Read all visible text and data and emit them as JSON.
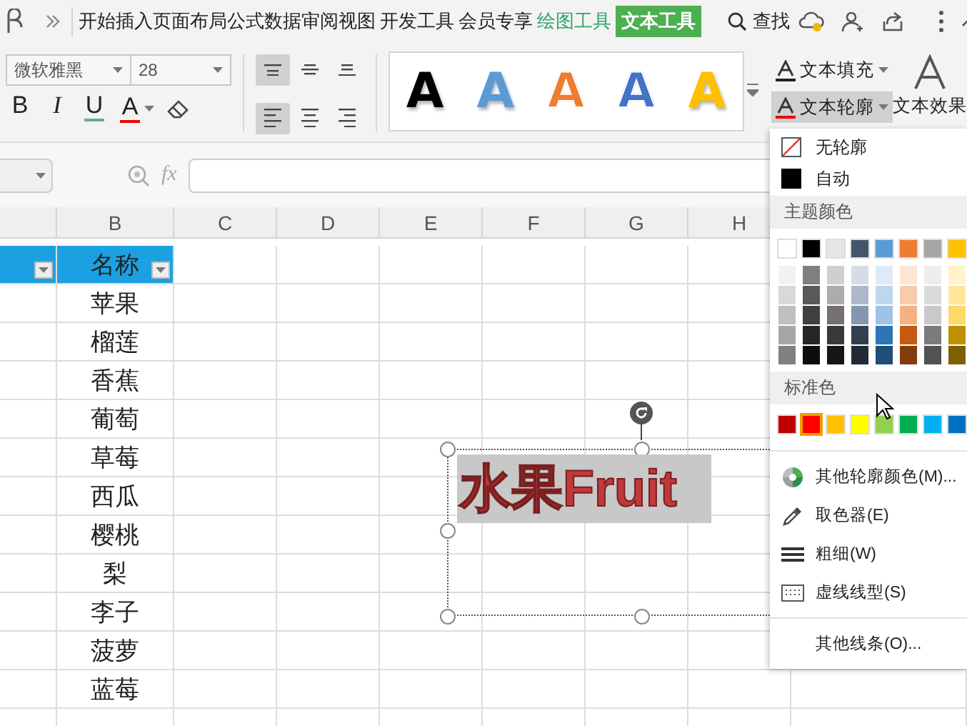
{
  "title_bar": {
    "tabs": [
      {
        "label": "开始",
        "kind": "normal",
        "selected": false
      },
      {
        "label": "插入",
        "kind": "normal",
        "selected": false
      },
      {
        "label": "页面布局",
        "kind": "normal",
        "selected": false
      },
      {
        "label": "公式",
        "kind": "normal",
        "selected": false
      },
      {
        "label": "数据",
        "kind": "normal",
        "selected": false
      },
      {
        "label": "审阅",
        "kind": "normal",
        "selected": false
      },
      {
        "label": "视图",
        "kind": "normal",
        "selected": false
      },
      {
        "label": "开发工具",
        "kind": "normal",
        "selected": false
      },
      {
        "label": "会员专享",
        "kind": "normal",
        "selected": false
      },
      {
        "label": "绘图工具",
        "kind": "context",
        "selected": false
      },
      {
        "label": "文本工具",
        "kind": "context",
        "selected": true
      }
    ],
    "search": "查找"
  },
  "ribbon": {
    "font_name": "微软雅黑",
    "font_size": "28",
    "format_buttons": [
      {
        "kind": "bold",
        "label": "B"
      },
      {
        "kind": "italic",
        "label": "I"
      },
      {
        "kind": "underline",
        "label": "U"
      },
      {
        "kind": "font_color",
        "label": "A"
      }
    ],
    "align_buttons": [
      {
        "kind": "top",
        "selected": true
      },
      {
        "kind": "middle",
        "selected": false
      },
      {
        "kind": "bottom",
        "selected": false
      },
      {
        "kind": "left",
        "selected": true
      },
      {
        "kind": "center",
        "selected": false
      },
      {
        "kind": "right",
        "selected": false
      }
    ],
    "text_styles": [
      {
        "label": "A",
        "kind": "fill",
        "color": "#000000"
      },
      {
        "label": "A",
        "kind": "fill",
        "color": "#5b9bd5"
      },
      {
        "label": "A",
        "kind": "outline",
        "color": "#ed7d31"
      },
      {
        "label": "A",
        "kind": "outline",
        "color": "#4472c4"
      },
      {
        "label": "A",
        "kind": "fill",
        "color": "#ffc000"
      }
    ],
    "text_fill": "文本填充",
    "text_outline": {
      "label": "文本轮廓",
      "selected": true
    },
    "text_effect": "文本效果"
  },
  "formula_bar": {
    "fx": "fx"
  },
  "sheet": {
    "columns": [
      "B",
      "C",
      "D",
      "E",
      "F",
      "G",
      "H"
    ],
    "header": "名称",
    "rows": [
      "苹果",
      "榴莲",
      "香蕉",
      "葡萄",
      "草莓",
      "西瓜",
      "樱桃",
      "梨",
      "李子",
      "菠萝",
      "蓝莓"
    ]
  },
  "text_box": {
    "text": "水果Fruit"
  },
  "outline_menu": {
    "top_items": [
      {
        "kind": "none",
        "label": "无轮廓"
      },
      {
        "kind": "auto",
        "label": "自动"
      }
    ],
    "theme_title": "主题颜色",
    "theme_colors": [
      {
        "color": "#ffffff",
        "selected": false,
        "shades": [
          {
            "color": "#f2f2f2",
            "selected": false
          },
          {
            "color": "#d9d9d9",
            "selected": false
          },
          {
            "color": "#bfbfbf",
            "selected": false
          },
          {
            "color": "#a6a6a6",
            "selected": false
          },
          {
            "color": "#808080",
            "selected": false
          }
        ]
      },
      {
        "color": "#000000",
        "selected": false,
        "shades": [
          {
            "color": "#7f7f7f",
            "selected": false
          },
          {
            "color": "#595959",
            "selected": false
          },
          {
            "color": "#404040",
            "selected": false
          },
          {
            "color": "#262626",
            "selected": false
          },
          {
            "color": "#0d0d0d",
            "selected": false
          }
        ]
      },
      {
        "color": "#e7e6e6",
        "selected": false,
        "shades": [
          {
            "color": "#d0cece",
            "selected": false
          },
          {
            "color": "#aeabab",
            "selected": false
          },
          {
            "color": "#757171",
            "selected": false
          },
          {
            "color": "#3b3838",
            "selected": false
          },
          {
            "color": "#171616",
            "selected": false
          }
        ]
      },
      {
        "color": "#44546a",
        "selected": false,
        "shades": [
          {
            "color": "#d6dce4",
            "selected": false
          },
          {
            "color": "#adb9ca",
            "selected": false
          },
          {
            "color": "#8497b0",
            "selected": false
          },
          {
            "color": "#333f4f",
            "selected": false
          },
          {
            "color": "#222a35",
            "selected": false
          }
        ]
      },
      {
        "color": "#5b9bd5",
        "selected": false,
        "shades": [
          {
            "color": "#deebf6",
            "selected": false
          },
          {
            "color": "#bdd7ee",
            "selected": false
          },
          {
            "color": "#9dc3e6",
            "selected": false
          },
          {
            "color": "#2e75b5",
            "selected": false
          },
          {
            "color": "#1f4e79",
            "selected": false
          }
        ]
      },
      {
        "color": "#ed7d31",
        "selected": false,
        "shades": [
          {
            "color": "#fbe5d5",
            "selected": false
          },
          {
            "color": "#f7cbac",
            "selected": false
          },
          {
            "color": "#f4b183",
            "selected": false
          },
          {
            "color": "#c55a11",
            "selected": false
          },
          {
            "color": "#833c0b",
            "selected": false
          }
        ]
      },
      {
        "color": "#a5a5a5",
        "selected": false,
        "shades": [
          {
            "color": "#ededed",
            "selected": false
          },
          {
            "color": "#dbdbdb",
            "selected": false
          },
          {
            "color": "#c9c9c9",
            "selected": false
          },
          {
            "color": "#7b7b7b",
            "selected": false
          },
          {
            "color": "#525252",
            "selected": false
          }
        ]
      },
      {
        "color": "#ffc000",
        "selected": false,
        "shades": [
          {
            "color": "#fff2cc",
            "selected": false
          },
          {
            "color": "#ffe699",
            "selected": false
          },
          {
            "color": "#ffd966",
            "selected": false
          },
          {
            "color": "#bf9000",
            "selected": false
          },
          {
            "color": "#7f6000",
            "selected": false
          }
        ]
      }
    ],
    "standard_title": "标准色",
    "standard_colors": [
      {
        "color": "#c00000",
        "selected": false
      },
      {
        "color": "#ff0000",
        "selected": true
      },
      {
        "color": "#ffc000",
        "selected": false
      },
      {
        "color": "#ffff00",
        "selected": false
      },
      {
        "color": "#92d050",
        "selected": false
      },
      {
        "color": "#00b050",
        "selected": false
      },
      {
        "color": "#00b0f0",
        "selected": false
      },
      {
        "color": "#0070c0",
        "selected": false
      }
    ],
    "items": [
      {
        "kind": "palette",
        "label": "其他轮廓颜色(M)..."
      },
      {
        "kind": "picker",
        "label": "取色器(E)"
      },
      {
        "kind": "weight",
        "label": "粗细(W)"
      },
      {
        "kind": "dash",
        "label": "虚线线型(S)"
      },
      {
        "kind": "lines",
        "label": "其他线条(O)..."
      }
    ]
  }
}
